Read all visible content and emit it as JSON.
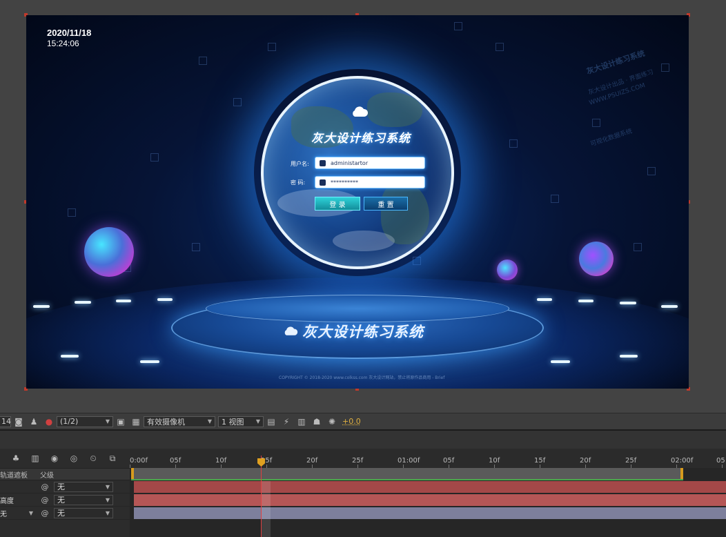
{
  "composition": {
    "date": "2020/11/18",
    "time": "15:24:06",
    "title": "灰大设计练习系统",
    "username_label": "用户名:",
    "password_label": "密 码:",
    "username_value": "administartor",
    "password_value": "**********",
    "login_button": "登 录",
    "reset_button": "重 置",
    "platform_title": "灰大设计练习系统",
    "copyright": "COPYRIGHT © 2018-2020 www.colkss.com 灰大设计网站，禁止将原作品商用 - Brief"
  },
  "toolbar": {
    "zoom_value": "14",
    "resolution": "(1/2)",
    "camera": "有效摄像机",
    "views": "1 视图",
    "exposure": "+0.0"
  },
  "timeline": {
    "columns": {
      "matte": "轨道遮板",
      "parent": "父级"
    },
    "ruler_labels": [
      "0:00f",
      "05f",
      "10f",
      "15f",
      "20f",
      "25f",
      "01:00f",
      "05f",
      "10f",
      "15f",
      "20f",
      "25f",
      "02:00f",
      "05"
    ],
    "layers": [
      {
        "left_text": "",
        "parent": "无"
      },
      {
        "left_text": "高度",
        "parent": "无"
      },
      {
        "left_text": "无",
        "parent": "无"
      }
    ]
  }
}
